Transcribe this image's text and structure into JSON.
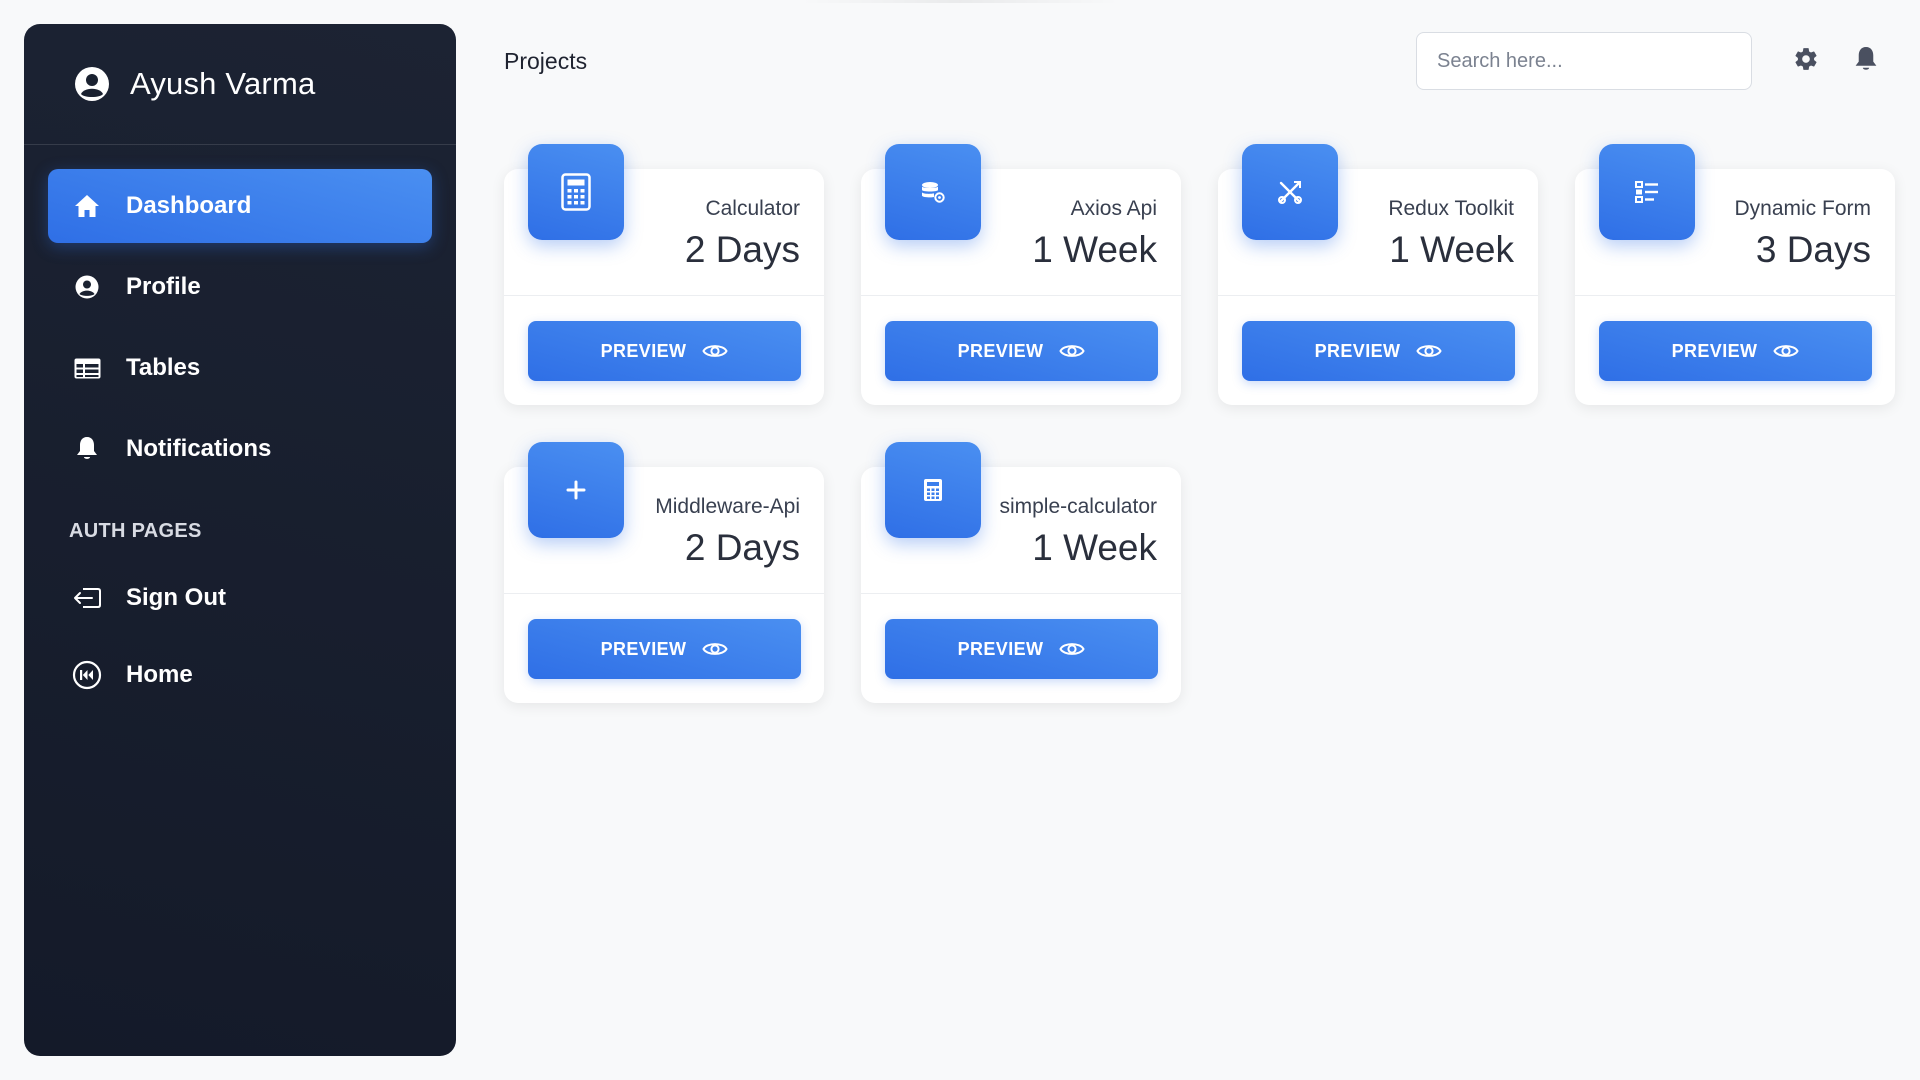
{
  "user": {
    "name": "Ayush Varma"
  },
  "nav": {
    "items": [
      {
        "label": "Dashboard",
        "icon": "home-icon",
        "active": true
      },
      {
        "label": "Profile",
        "icon": "user-circle-icon"
      },
      {
        "label": "Tables",
        "icon": "table-icon"
      },
      {
        "label": "Notifications",
        "icon": "bell-icon"
      }
    ],
    "section_title": "AUTH PAGES",
    "auth_items": [
      {
        "label": "Sign Out",
        "icon": "sign-out-icon"
      },
      {
        "label": "Home",
        "icon": "rewind-circle-icon"
      }
    ]
  },
  "header": {
    "title": "Projects",
    "search_placeholder": "Search here..."
  },
  "projects": [
    {
      "name": "Calculator",
      "duration": "2 Days",
      "icon": "calculator-icon",
      "button": "PREVIEW"
    },
    {
      "name": "Axios Api",
      "duration": "1 Week",
      "icon": "database-gear-icon",
      "button": "PREVIEW"
    },
    {
      "name": "Redux Toolkit",
      "duration": "1 Week",
      "icon": "tools-icon",
      "button": "PREVIEW"
    },
    {
      "name": "Dynamic Form",
      "duration": "3 Days",
      "icon": "checklist-icon",
      "button": "PREVIEW"
    },
    {
      "name": "Middleware-Api",
      "duration": "2 Days",
      "icon": "plus-icon",
      "button": "PREVIEW"
    },
    {
      "name": "simple-calculator",
      "duration": "1 Week",
      "icon": "calculator-icon",
      "button": "PREVIEW"
    }
  ],
  "colors": {
    "sidebar": "#1a2130",
    "accent": "#3b7eec",
    "background": "#f8f9fa"
  }
}
